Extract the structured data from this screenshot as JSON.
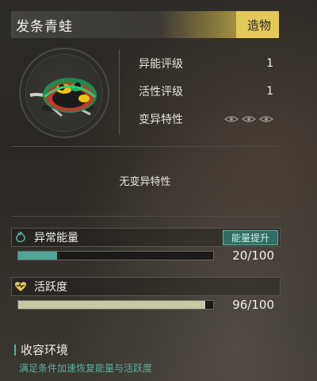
{
  "header": {
    "title": "发条青蛙",
    "tag": "造物"
  },
  "portrait": {
    "icon": "clockwork-frog-icon"
  },
  "stats": [
    {
      "label": "异能评级",
      "value": "1"
    },
    {
      "label": "活性评级",
      "value": "1"
    },
    {
      "label": "变异特性",
      "value": ""
    }
  ],
  "traits": {
    "empty_text": "无变异特性"
  },
  "energy": {
    "label": "异常能量",
    "button": "能量提升",
    "value_text": "20/100",
    "fraction": 0.2,
    "color": "#4fa597",
    "icon": "flame-icon"
  },
  "activity": {
    "label": "活跃度",
    "value_text": "96/100",
    "fraction": 0.96,
    "color": "#c8c8a4",
    "icon": "heartbeat-icon"
  },
  "environment": {
    "title": "收容环境",
    "desc": "满足条件加速恢复能量与活跃度"
  },
  "colors": {
    "accent": "#e3c95a",
    "teal": "#5fb3a2"
  }
}
